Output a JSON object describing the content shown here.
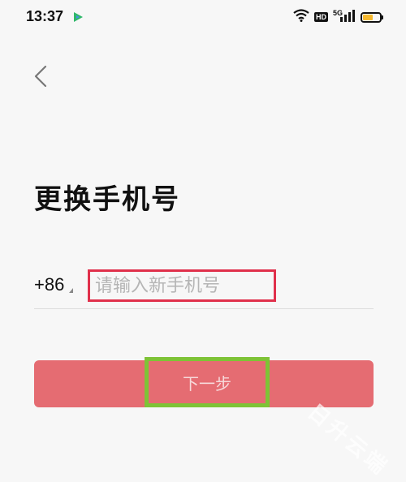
{
  "status_bar": {
    "time": "13:37",
    "hd_label": "HD",
    "network_type": "5G",
    "battery_level": 0.6,
    "battery_color": "#f5b82e"
  },
  "icons": {
    "back": "chevron-left-icon",
    "wifi": "wifi-icon",
    "signal": "signal-icon",
    "battery": "battery-icon",
    "app": "app-notification-icon"
  },
  "page": {
    "title": "更换手机号"
  },
  "phone_form": {
    "country_code": "+86",
    "placeholder": "请输入新手机号",
    "value": ""
  },
  "next_button": {
    "label": "下一步",
    "color": "#e56c72"
  },
  "annotation_colors": {
    "input_highlight": "#e0304b",
    "button_highlight": "#7ec336"
  },
  "watermark": {
    "text": "日升云端"
  }
}
